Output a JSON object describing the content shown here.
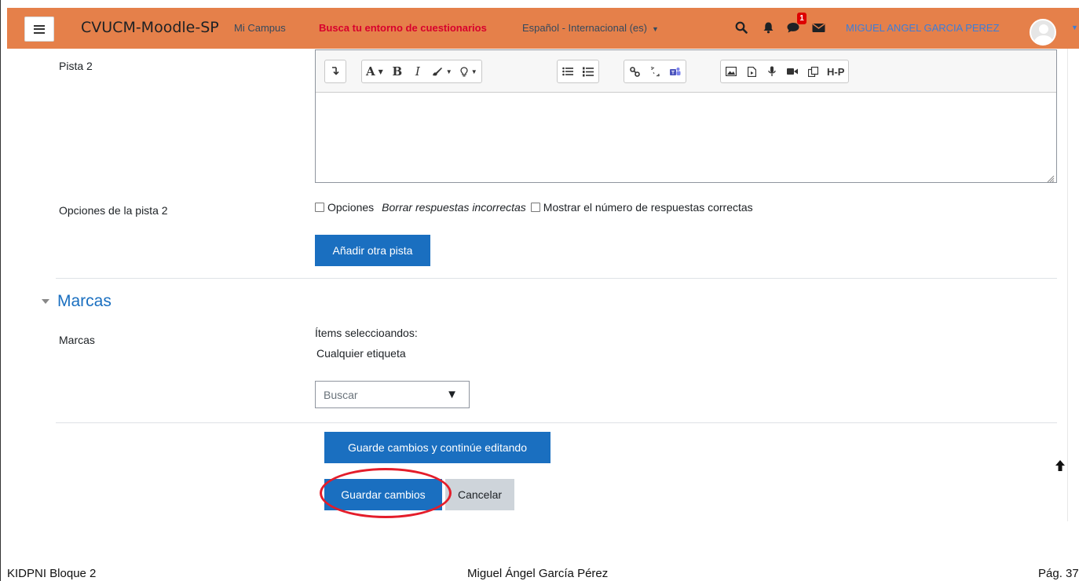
{
  "navbar": {
    "brand": "CVUCM-Moodle-SP",
    "mi_campus": "Mi Campus",
    "busca": "Busca tu entorno de cuestionarios",
    "language": "Español - Internacional (es)",
    "notification_count": "1",
    "user_name": "MIGUEL ANGEL GARCIA PEREZ",
    "bg_color": "#e5804a"
  },
  "pista2": {
    "label": "Pista 2",
    "content": "",
    "toolbar": {
      "font_btn": "A",
      "bold": "B",
      "italic": "I",
      "h5p": "H-P"
    }
  },
  "pista2_options": {
    "label": "Opciones de la pista 2",
    "opciones": "Opciones",
    "borrar": "Borrar respuestas incorrectas",
    "mostrar": "Mostrar el número de respuestas correctas"
  },
  "add_hint_button": "Añadir otra pista",
  "marcas_section": {
    "title": "Marcas",
    "label": "Marcas",
    "selected_title": "Ítems seleccioandos:",
    "selected_value": "Cualquier etiqueta",
    "search_select": "Buscar"
  },
  "actions": {
    "save_continue": "Guarde cambios y continúe editando",
    "save": "Guardar cambios",
    "cancel": "Cancelar"
  },
  "footer": {
    "left": "KIDPNI Bloque 2",
    "center": "Miguel Ángel García Pérez",
    "right": "Pág. 37"
  },
  "colors": {
    "primary": "#1a6fc0",
    "highlight": "#e41d2a"
  }
}
